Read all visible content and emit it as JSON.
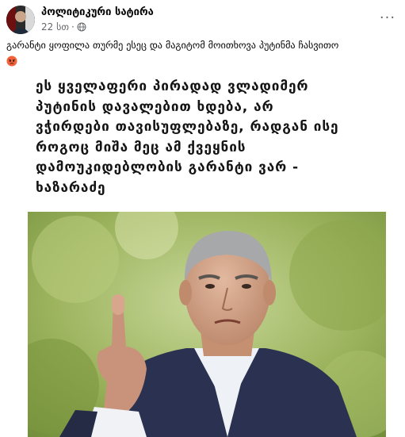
{
  "post": {
    "page_name": "პოლიტიკური სატირა",
    "time": "22 სთ",
    "privacy_icon": "globe-icon",
    "more_icon": "more-dots-icon",
    "more_label": "···",
    "caption": "გარანტი ყოფილა თურმე ესეც და მაგიტომ მოითხოვა პუტინმა ჩასვითო",
    "caption_emoji": "angry-face-emoji"
  },
  "card": {
    "quote": "ეს ყველაფერი პირადად ვლადიმერ\nპუტინის დავალებით ხდება, არ\nვჭირდები თავისუფლებაზე, რადგან ისე\nროგოც მიშა მეც ამ ქვეყნის\nდამოუკიდებლობის გარანტი ვარ -\nხაზარაძე",
    "photo": "photo-of-man-raising-index-finger"
  },
  "colors": {
    "text": "#050505",
    "secondary": "#65676b",
    "quote_text": "#141414"
  }
}
